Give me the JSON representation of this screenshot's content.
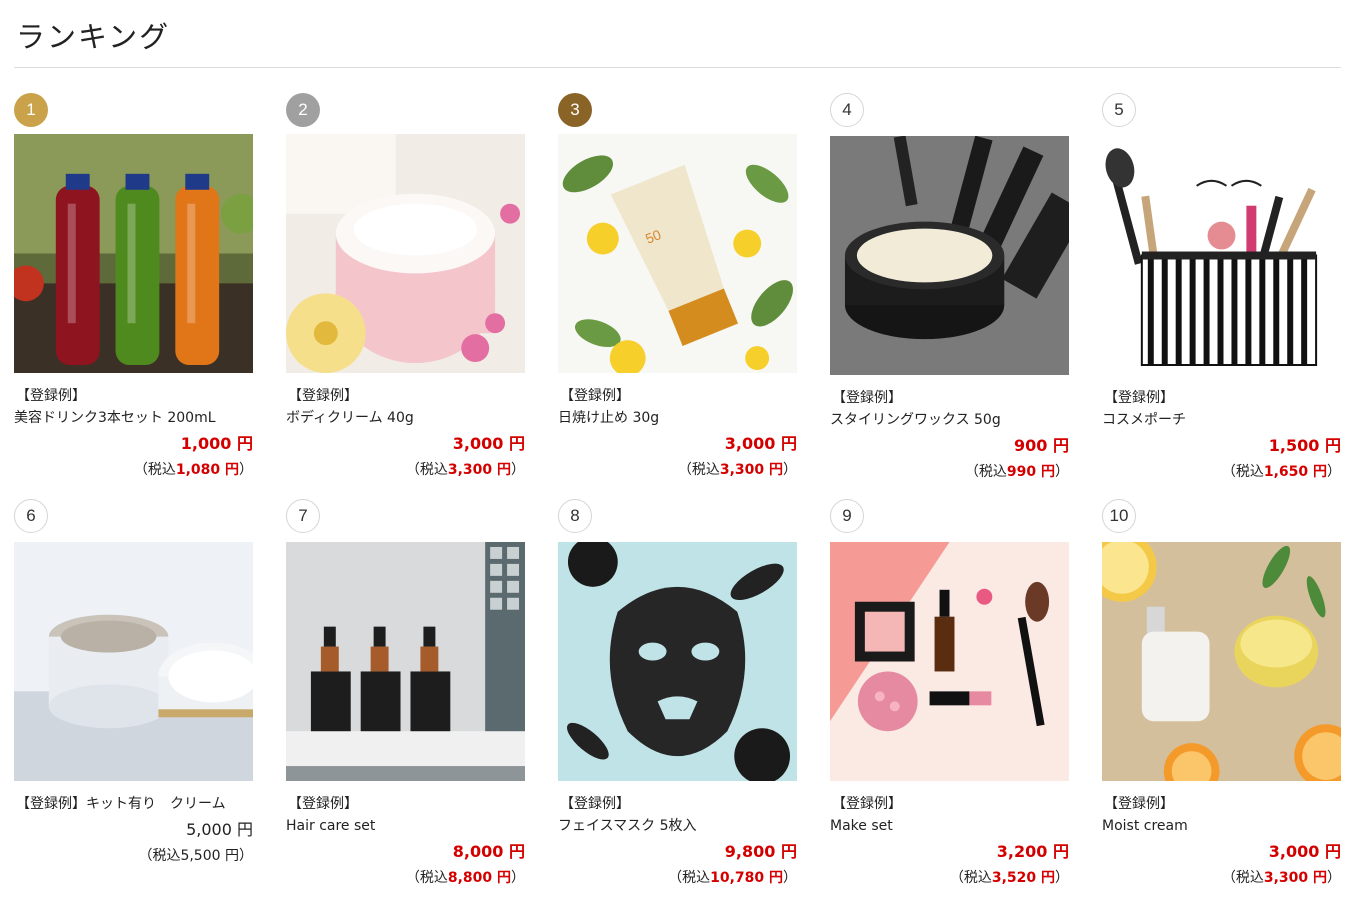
{
  "page": {
    "title": "ランキング"
  },
  "labels": {
    "tag": "【登録例】",
    "yen": "円",
    "tax_open": "（税込",
    "tax_close": "）"
  },
  "colors": {
    "gold": "#c9a24a",
    "silver": "#a0a0a0",
    "bronze": "#8a6326",
    "price_red": "#d40000"
  },
  "products": [
    {
      "rank": "1",
      "name": "美容ドリンク3本セット 200mL",
      "price": "1,000",
      "tax_price": "1,080",
      "image": "juice-bottles-image"
    },
    {
      "rank": "2",
      "name": "ボディクリーム 40g",
      "price": "3,000",
      "tax_price": "3,300",
      "image": "body-cream-jar-image"
    },
    {
      "rank": "3",
      "name": "日焼け止め 30g",
      "price": "3,000",
      "tax_price": "3,300",
      "image": "sunscreen-tube-image"
    },
    {
      "rank": "4",
      "name": "スタイリングワックス 50g",
      "price": "900",
      "tax_price": "990",
      "image": "styling-wax-image"
    },
    {
      "rank": "5",
      "name": "コスメポーチ",
      "price": "1,500",
      "tax_price": "1,650",
      "image": "cosmetic-pouch-image"
    },
    {
      "rank": "6",
      "name": "キット有り　クリーム",
      "price": "5,000",
      "tax_price": "5,500",
      "image": "cream-jars-image"
    },
    {
      "rank": "7",
      "name": "Hair care set",
      "price": "8,000",
      "tax_price": "8,800",
      "image": "hair-care-bottles-image"
    },
    {
      "rank": "8",
      "name": "フェイスマスク 5枚入",
      "price": "9,800",
      "tax_price": "10,780",
      "image": "face-mask-image"
    },
    {
      "rank": "9",
      "name": "Make set",
      "price": "3,200",
      "tax_price": "3,520",
      "image": "makeup-set-image"
    },
    {
      "rank": "10",
      "name": "Moist cream",
      "price": "3,000",
      "tax_price": "3,300",
      "image": "moist-cream-bottle-image"
    }
  ]
}
